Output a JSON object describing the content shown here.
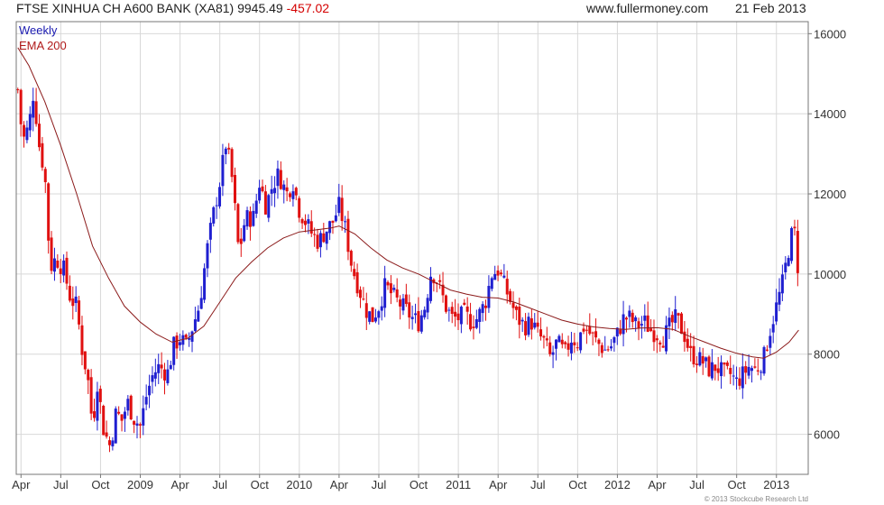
{
  "header": {
    "title": "FTSE XINHUA CH A600 BANK (XA81) 9945.49",
    "change": "-457.02",
    "site": "www.fullermoney.com",
    "date": "21 Feb 2013"
  },
  "copyright": "© 2013 Stockcube Research Ltd",
  "colors": {
    "up": "#1f1fd0",
    "down": "#e01010",
    "ema": "#8b1a1a",
    "grid": "#d8d8d8"
  },
  "chart_data": {
    "type": "line",
    "subtype": "weekly candlestick chart with EMA overlay",
    "legend": [
      "Weekly",
      "EMA 200"
    ],
    "legend_position": "top-left",
    "y_axis_side": "right",
    "ylim": [
      5000,
      16300
    ],
    "yticks": [
      6000,
      8000,
      10000,
      12000,
      14000,
      16000
    ],
    "ytick_labels": [
      "6000",
      "8000",
      "10000",
      "12000",
      "14000",
      "16000"
    ],
    "xlim": [
      2008.22,
      2013.2
    ],
    "xticks": [
      {
        "label": "Apr",
        "x": 2008.25
      },
      {
        "label": "Jul",
        "x": 2008.5
      },
      {
        "label": "Oct",
        "x": 2008.75
      },
      {
        "label": "2009",
        "x": 2009.0
      },
      {
        "label": "Apr",
        "x": 2009.25
      },
      {
        "label": "Jul",
        "x": 2009.5
      },
      {
        "label": "Oct",
        "x": 2009.75
      },
      {
        "label": "2010",
        "x": 2010.0
      },
      {
        "label": "Apr",
        "x": 2010.25
      },
      {
        "label": "Jul",
        "x": 2010.5
      },
      {
        "label": "Oct",
        "x": 2010.75
      },
      {
        "label": "2011",
        "x": 2011.0
      },
      {
        "label": "Apr",
        "x": 2011.25
      },
      {
        "label": "Jul",
        "x": 2011.5
      },
      {
        "label": "Oct",
        "x": 2011.75
      },
      {
        "label": "2012",
        "x": 2012.0
      },
      {
        "label": "Apr",
        "x": 2012.25
      },
      {
        "label": "Jul",
        "x": 2012.5
      },
      {
        "label": "Oct",
        "x": 2012.75
      },
      {
        "label": "2013",
        "x": 2013.0
      }
    ],
    "grid": true,
    "price_path": [
      [
        2008.23,
        14600
      ],
      [
        2008.26,
        13300
      ],
      [
        2008.3,
        13700
      ],
      [
        2008.33,
        14600
      ],
      [
        2008.36,
        13300
      ],
      [
        2008.4,
        12500
      ],
      [
        2008.42,
        11000
      ],
      [
        2008.44,
        10200
      ],
      [
        2008.47,
        10400
      ],
      [
        2008.52,
        10100
      ],
      [
        2008.56,
        9400
      ],
      [
        2008.6,
        9200
      ],
      [
        2008.63,
        8200
      ],
      [
        2008.67,
        7400
      ],
      [
        2008.7,
        6200
      ],
      [
        2008.73,
        7300
      ],
      [
        2008.77,
        6100
      ],
      [
        2008.81,
        5700
      ],
      [
        2008.85,
        6600
      ],
      [
        2008.88,
        6300
      ],
      [
        2008.92,
        6800
      ],
      [
        2008.96,
        6400
      ],
      [
        2009.0,
        6200
      ],
      [
        2009.04,
        7000
      ],
      [
        2009.08,
        7500
      ],
      [
        2009.12,
        7700
      ],
      [
        2009.17,
        7500
      ],
      [
        2009.21,
        8200
      ],
      [
        2009.25,
        8400
      ],
      [
        2009.29,
        8200
      ],
      [
        2009.33,
        8700
      ],
      [
        2009.37,
        9200
      ],
      [
        2009.42,
        10600
      ],
      [
        2009.46,
        11500
      ],
      [
        2009.5,
        12300
      ],
      [
        2009.54,
        13300
      ],
      [
        2009.58,
        12300
      ],
      [
        2009.62,
        10500
      ],
      [
        2009.66,
        11400
      ],
      [
        2009.71,
        11400
      ],
      [
        2009.75,
        12300
      ],
      [
        2009.79,
        11700
      ],
      [
        2009.83,
        12200
      ],
      [
        2009.87,
        12500
      ],
      [
        2009.92,
        12000
      ],
      [
        2009.96,
        12300
      ],
      [
        2010.0,
        11600
      ],
      [
        2010.04,
        11300
      ],
      [
        2010.08,
        11000
      ],
      [
        2010.12,
        10800
      ],
      [
        2010.17,
        11100
      ],
      [
        2010.21,
        11300
      ],
      [
        2010.25,
        11700
      ],
      [
        2010.29,
        11100
      ],
      [
        2010.33,
        10200
      ],
      [
        2010.37,
        9700
      ],
      [
        2010.42,
        9100
      ],
      [
        2010.46,
        8900
      ],
      [
        2010.5,
        9200
      ],
      [
        2010.54,
        9700
      ],
      [
        2010.58,
        9500
      ],
      [
        2010.62,
        9300
      ],
      [
        2010.67,
        9100
      ],
      [
        2010.71,
        8900
      ],
      [
        2010.75,
        8800
      ],
      [
        2010.79,
        9200
      ],
      [
        2010.83,
        10100
      ],
      [
        2010.87,
        9800
      ],
      [
        2010.92,
        9200
      ],
      [
        2010.96,
        8900
      ],
      [
        2011.0,
        8900
      ],
      [
        2011.04,
        9000
      ],
      [
        2011.08,
        8800
      ],
      [
        2011.12,
        8900
      ],
      [
        2011.17,
        9300
      ],
      [
        2011.21,
        10000
      ],
      [
        2011.25,
        10100
      ],
      [
        2011.29,
        9700
      ],
      [
        2011.33,
        9300
      ],
      [
        2011.37,
        8900
      ],
      [
        2011.42,
        8700
      ],
      [
        2011.46,
        8800
      ],
      [
        2011.5,
        8500
      ],
      [
        2011.54,
        8300
      ],
      [
        2011.58,
        7900
      ],
      [
        2011.62,
        8300
      ],
      [
        2011.67,
        8000
      ],
      [
        2011.71,
        8400
      ],
      [
        2011.75,
        8300
      ],
      [
        2011.79,
        8700
      ],
      [
        2011.83,
        8500
      ],
      [
        2011.87,
        8300
      ],
      [
        2011.92,
        8100
      ],
      [
        2011.96,
        8200
      ],
      [
        2012.0,
        8500
      ],
      [
        2012.04,
        8900
      ],
      [
        2012.08,
        8900
      ],
      [
        2012.12,
        8700
      ],
      [
        2012.17,
        8800
      ],
      [
        2012.21,
        8600
      ],
      [
        2012.25,
        8500
      ],
      [
        2012.29,
        8400
      ],
      [
        2012.33,
        8700
      ],
      [
        2012.37,
        8900
      ],
      [
        2012.42,
        8500
      ],
      [
        2012.46,
        8000
      ],
      [
        2012.5,
        7900
      ],
      [
        2012.54,
        7800
      ],
      [
        2012.58,
        7600
      ],
      [
        2012.62,
        7700
      ],
      [
        2012.67,
        7500
      ],
      [
        2012.71,
        7500
      ],
      [
        2012.75,
        7300
      ],
      [
        2012.79,
        7500
      ],
      [
        2012.83,
        7700
      ],
      [
        2012.87,
        7600
      ],
      [
        2012.92,
        7900
      ],
      [
        2012.96,
        8600
      ],
      [
        2013.0,
        9200
      ],
      [
        2013.04,
        9800
      ],
      [
        2013.08,
        10700
      ],
      [
        2013.11,
        11200
      ],
      [
        2013.14,
        9950
      ]
    ],
    "ema_200": [
      [
        2008.23,
        15650
      ],
      [
        2008.3,
        15200
      ],
      [
        2008.4,
        14300
      ],
      [
        2008.5,
        13200
      ],
      [
        2008.6,
        12000
      ],
      [
        2008.7,
        10700
      ],
      [
        2008.8,
        9900
      ],
      [
        2008.9,
        9200
      ],
      [
        2009.0,
        8800
      ],
      [
        2009.1,
        8500
      ],
      [
        2009.2,
        8300
      ],
      [
        2009.3,
        8400
      ],
      [
        2009.4,
        8700
      ],
      [
        2009.5,
        9300
      ],
      [
        2009.6,
        9900
      ],
      [
        2009.7,
        10300
      ],
      [
        2009.8,
        10650
      ],
      [
        2009.9,
        10900
      ],
      [
        2010.0,
        11050
      ],
      [
        2010.1,
        11100
      ],
      [
        2010.2,
        11150
      ],
      [
        2010.25,
        11200
      ],
      [
        2010.35,
        11000
      ],
      [
        2010.45,
        10650
      ],
      [
        2010.55,
        10350
      ],
      [
        2010.65,
        10150
      ],
      [
        2010.75,
        10000
      ],
      [
        2010.85,
        9800
      ],
      [
        2010.95,
        9600
      ],
      [
        2011.05,
        9500
      ],
      [
        2011.15,
        9420
      ],
      [
        2011.25,
        9400
      ],
      [
        2011.35,
        9300
      ],
      [
        2011.45,
        9150
      ],
      [
        2011.55,
        9000
      ],
      [
        2011.65,
        8850
      ],
      [
        2011.75,
        8750
      ],
      [
        2011.85,
        8680
      ],
      [
        2011.95,
        8640
      ],
      [
        2012.05,
        8620
      ],
      [
        2012.15,
        8650
      ],
      [
        2012.25,
        8660
      ],
      [
        2012.35,
        8620
      ],
      [
        2012.45,
        8450
      ],
      [
        2012.55,
        8300
      ],
      [
        2012.65,
        8150
      ],
      [
        2012.75,
        8020
      ],
      [
        2012.85,
        7930
      ],
      [
        2012.92,
        7900
      ],
      [
        2013.0,
        8050
      ],
      [
        2013.08,
        8300
      ],
      [
        2013.14,
        8600
      ]
    ]
  }
}
